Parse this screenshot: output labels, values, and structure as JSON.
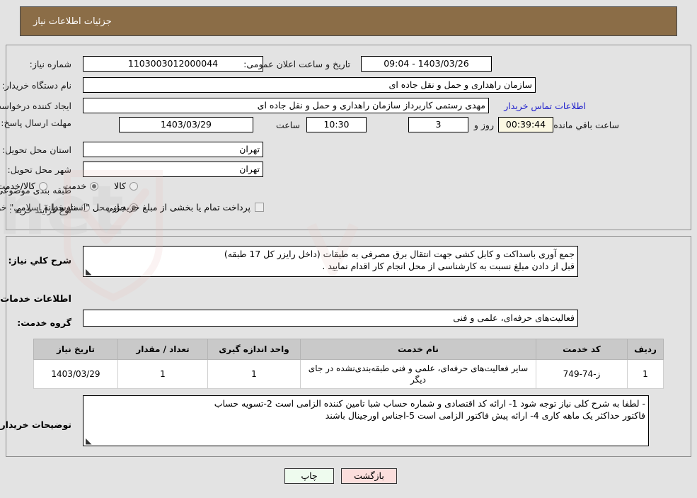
{
  "header": {
    "title": "جزئیات اطلاعات نیاز"
  },
  "form": {
    "need_number_label": "شماره نیاز:",
    "need_number_value": "1103003012000044",
    "public_announce_label": "تاریخ و ساعت اعلان عمومی:",
    "public_announce_value": "1403/03/26 - 09:04",
    "buyer_org_label": "نام دستگاه خریدار:",
    "buyer_org_value": "سازمان راهداری و حمل و نقل جاده ای",
    "requester_label": "ایجاد کننده درخواست:",
    "requester_value": "مهدی رستمی کاربرداز سازمان راهداری و حمل و نقل جاده ای",
    "contact_link": "اطلاعات تماس خریدار",
    "deadline_label": "مهلت ارسال پاسخ: تا تاریخ:",
    "deadline_date": "1403/03/29",
    "hour_label": "ساعت",
    "deadline_time": "10:30",
    "days_remaining": "3",
    "days_label": "روز و",
    "countdown": "00:39:44",
    "countdown_label": "ساعت باقي مانده",
    "province_label": "استان محل تحویل:",
    "province_value": "تهران",
    "city_label": "شهر محل تحویل:",
    "city_value": "تهران",
    "category_label": "طبقه بندی موضوعی:",
    "category_options": [
      {
        "label": "کالا",
        "selected": false
      },
      {
        "label": "خدمت",
        "selected": true
      },
      {
        "label": "کالا/خدمت",
        "selected": false
      }
    ],
    "process_label": "نوع فرآیند خرید :",
    "process_options": [
      {
        "label": "جزیي",
        "selected": true
      },
      {
        "label": "متوسط",
        "selected": false
      }
    ],
    "treasury_checkbox_label": "پرداخت تمام یا بخشی از مبلغ خرید،از محل \"اسناد خزانه اسلامی\" خواهد بود.",
    "treasury_checked": false
  },
  "description": {
    "label": "شرح کلي نیاز:",
    "line1": "جمع آوری باسداکت و کابل کشی جهت انتقال برق مصرفی به طبقات (داخل رایزر کل 17 طبقه)",
    "line2": "قبل از دادن مبلغ نسبت به کارشناسی از محل انجام کار اقدام نمایید ."
  },
  "services_section": {
    "heading": "اطلاعات خدمات مورد نیاز",
    "group_label": "گروه خدمت:",
    "group_value": "فعالیت‌های حرفه‌ای، علمی و فنی"
  },
  "table": {
    "columns": [
      "ردیف",
      "کد خدمت",
      "نام خدمت",
      "واحد اندازه گیری",
      "تعداد / مقدار",
      "تاریخ نیاز"
    ],
    "rows": [
      {
        "row": "1",
        "code": "ز-74-749",
        "name": "سایر فعالیت‌های حرفه‌ای، علمی و فنی طبقه‌بندی‌نشده در جای دیگر",
        "unit": "1",
        "qty": "1",
        "date": "1403/03/29"
      }
    ]
  },
  "buyer_notes": {
    "label": "توضیحات خریدار:",
    "line1": "-    لطفا به شرح کلی نیاز توجه شود 1- ارائه کد اقتصادی و شماره حساب شبا تامین کننده الزامی است 2-تسویه حساب",
    "line2": "فاکتور حداکثر یک ماهه کاری 4- ارائه پیش فاکتور الزامی است 5-اجناس اورجینال باشند"
  },
  "buttons": {
    "print": "چاپ",
    "back": "بازگشت"
  },
  "watermark": {
    "text": "AriaTender.net"
  },
  "colors": {
    "header_bg": "#8b6d47",
    "page_bg": "#e3e3e3",
    "link": "#2020cc",
    "table_header_bg": "#c9c9c9",
    "print_btn_bg": "#eefbee",
    "back_btn_bg": "#fbdedc",
    "countdown_bg": "#fbf8e3"
  }
}
